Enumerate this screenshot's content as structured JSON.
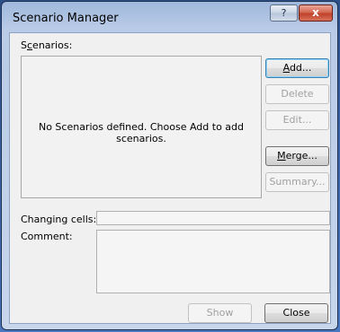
{
  "window": {
    "title": "Scenario Manager",
    "help_glyph": "?",
    "close_glyph": "x"
  },
  "labels": {
    "scenarios_pre": "S",
    "scenarios_ul": "c",
    "scenarios_post": "enarios:",
    "changing_cells": "Changing cells:",
    "comment": "Comment:"
  },
  "list": {
    "empty_message": "No Scenarios defined. Choose Add to add scenarios."
  },
  "buttons": {
    "add_pre": "",
    "add_ul": "A",
    "add_post": "dd...",
    "delete": "Delete",
    "edit": "Edit...",
    "merge_pre": "",
    "merge_ul": "M",
    "merge_post": "erge...",
    "summary": "Summary...",
    "show": "Show",
    "close": "Close"
  },
  "fields": {
    "changing_cells_value": "",
    "comment_value": ""
  }
}
